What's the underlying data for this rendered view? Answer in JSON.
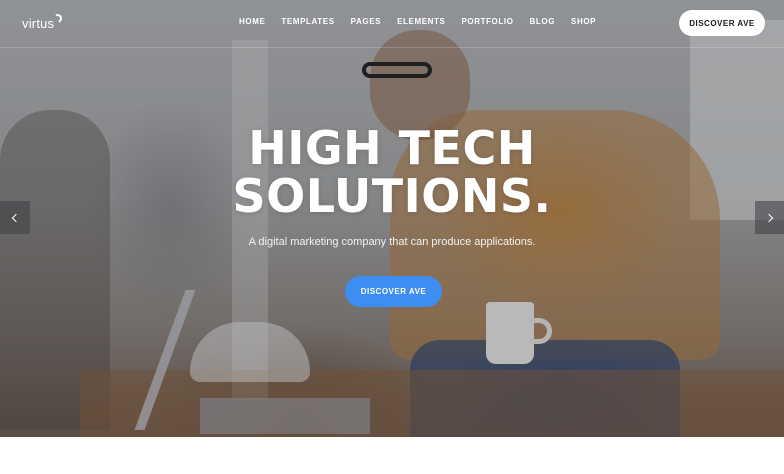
{
  "header": {
    "logo_text": "virtus",
    "nav": [
      {
        "label": "HOME"
      },
      {
        "label": "TEMPLATES"
      },
      {
        "label": "PAGES"
      },
      {
        "label": "ELEMENTS"
      },
      {
        "label": "PORTFOLIO"
      },
      {
        "label": "BLOG"
      },
      {
        "label": "SHOP"
      }
    ],
    "cta_label": "DISCOVER AVE"
  },
  "hero": {
    "title_line1": "HIGH TECH",
    "title_line2": "SOLUTIONS.",
    "subtitle": "A digital marketing company that can produce applications.",
    "cta_label": "DISCOVER AVE",
    "cta_color": "#3d8ef0"
  },
  "slider": {
    "prev_icon": "chevron-left-icon",
    "next_icon": "chevron-right-icon"
  }
}
